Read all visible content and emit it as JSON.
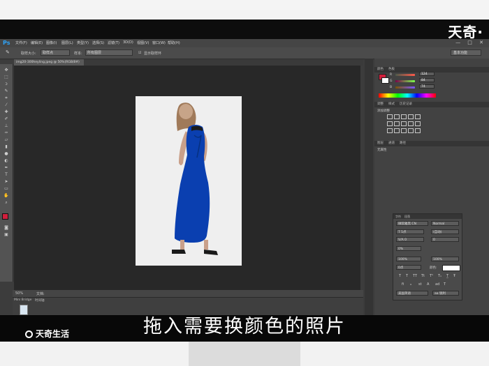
{
  "watermark": {
    "top_text": "天奇·",
    "bottom_text": "天奇生活"
  },
  "subtitle": "拖入需要换颜色的照片",
  "photoshop": {
    "logo": "Ps",
    "menu": [
      "文件(F)",
      "编辑(E)",
      "图像(I)",
      "图层(L)",
      "类型(Y)",
      "选择(S)",
      "滤镜(T)",
      "3D(D)",
      "视图(V)",
      "窗口(W)",
      "帮助(H)"
    ],
    "window_controls": "— □ ✕",
    "options_bar": {
      "sample_size_label": "取样大小:",
      "sample_size_value": "取样点",
      "sample_label": "样本:",
      "sample_value": "所有图层",
      "show_ring_label": "显示取样环",
      "workspace": "基本功能"
    },
    "document_tab": "img20-300heyling.jpeg @ 50%(RGB/8#)",
    "status": {
      "zoom": "50%",
      "info": "文档:"
    },
    "mini_bridge": {
      "tab1": "Mini Bridge",
      "tab2": "时间轴"
    },
    "color_panel": {
      "tabs": [
        "颜色",
        "色板"
      ],
      "r": "124",
      "g": "84",
      "b": "74",
      "fg_color": "#d01f3c",
      "bg_color": "#ffffff"
    },
    "adjust_panel": {
      "tabs": [
        "调整",
        "样式",
        "历史记录"
      ],
      "title": "添加调整"
    },
    "layers_panel": {
      "tabs": [
        "图层",
        "通道",
        "路径"
      ],
      "title": "无属性"
    },
    "character_panel": {
      "tabs": [
        "字符",
        "段落"
      ],
      "font_family": "微软雅黑 CN",
      "font_style": "Normal",
      "font_size": "T 5点",
      "leading": "(自动)",
      "kerning": "V/A 0",
      "tracking": "0",
      "scale_pct": "0%",
      "vscale": "100%",
      "hscale": "100%",
      "baseline": "0点",
      "color_label": "颜色:",
      "language": "美国英语",
      "aa": "aa 锐利"
    }
  },
  "colors": {
    "dress": "#0a3fb0",
    "ps_blue": "#2fa3f6"
  }
}
